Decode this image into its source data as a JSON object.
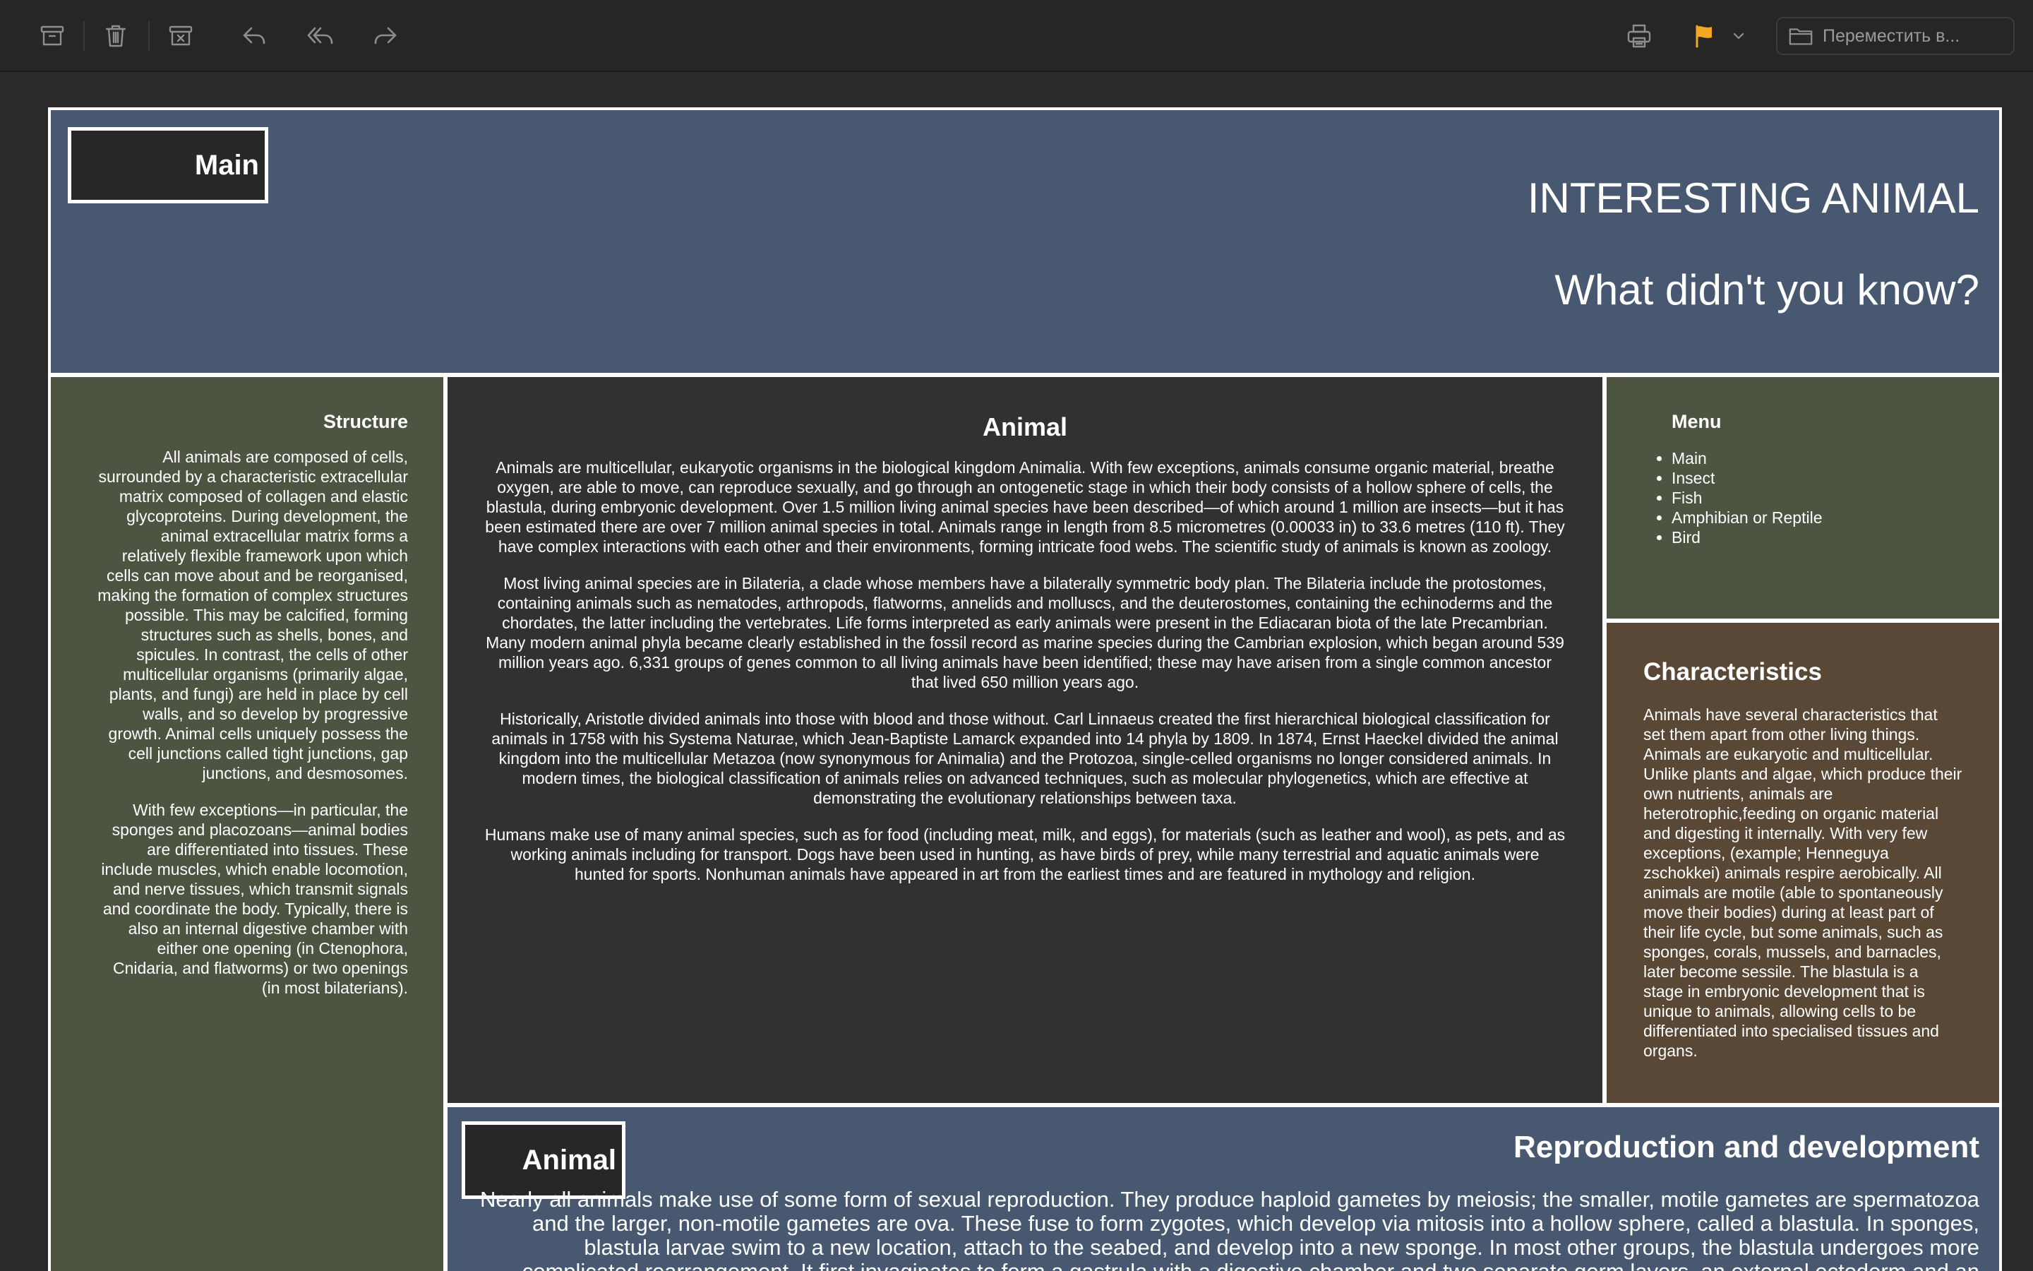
{
  "toolbar": {
    "buttons": [
      "archive-icon",
      "trash-icon",
      "junk-icon",
      "reply-icon",
      "reply-all-icon",
      "forward-icon",
      "print-icon",
      "flag-icon",
      "chevron-down-icon"
    ],
    "flag_color": "#f5a623",
    "move_to_placeholder": "Переместить в..."
  },
  "header": {
    "nav_button": "Main",
    "title": "INTERESTING ANIMAL",
    "subtitle": "What didn't you know?"
  },
  "structure": {
    "heading": "Structure",
    "paragraphs": [
      "All animals are composed of cells, surrounded by a characteristic extracellular matrix composed of collagen and elastic glycoproteins. During development, the animal extracellular matrix forms a relatively flexible framework upon which cells can move about and be reorganised, making the formation of complex structures possible. This may be calcified, forming structures such as shells, bones, and spicules. In contrast, the cells of other multicellular organisms (primarily algae, plants, and fungi) are held in place by cell walls, and so develop by progressive growth. Animal cells uniquely possess the cell junctions called tight junctions, gap junctions, and desmosomes.",
      "With few exceptions—in particular, the sponges and placozoans—animal bodies are differentiated into tissues. These include muscles, which enable locomotion, and nerve tissues, which transmit signals and coordinate the body. Typically, there is also an internal digestive chamber with either one opening (in Ctenophora, Cnidaria, and flatworms) or two openings (in most bilaterians)."
    ]
  },
  "animal": {
    "heading": "Animal",
    "paragraphs": [
      "Animals are multicellular, eukaryotic organisms in the biological kingdom Animalia. With few exceptions, animals consume organic material, breathe oxygen, are able to move, can reproduce sexually, and go through an ontogenetic stage in which their body consists of a hollow sphere of cells, the blastula, during embryonic development. Over 1.5 million living animal species have been described—of which around 1 million are insects—but it has been estimated there are over 7 million animal species in total. Animals range in length from 8.5 micrometres (0.00033 in) to 33.6 metres (110 ft). They have complex interactions with each other and their environments, forming intricate food webs. The scientific study of animals is known as zoology.",
      "Most living animal species are in Bilateria, a clade whose members have a bilaterally symmetric body plan. The Bilateria include the protostomes, containing animals such as nematodes, arthropods, flatworms, annelids and molluscs, and the deuterostomes, containing the echinoderms and the chordates, the latter including the vertebrates. Life forms interpreted as early animals were present in the Ediacaran biota of the late Precambrian. Many modern animal phyla became clearly established in the fossil record as marine species during the Cambrian explosion, which began around 539 million years ago. 6,331 groups of genes common to all living animals have been identified; these may have arisen from a single common ancestor that lived 650 million years ago.",
      "Historically, Aristotle divided animals into those with blood and those without. Carl Linnaeus created the first hierarchical biological classification for animals in 1758 with his Systema Naturae, which Jean-Baptiste Lamarck expanded into 14 phyla by 1809. In 1874, Ernst Haeckel divided the animal kingdom into the multicellular Metazoa (now synonymous for Animalia) and the Protozoa, single-celled organisms no longer considered animals. In modern times, the biological classification of animals relies on advanced techniques, such as molecular phylogenetics, which are effective at demonstrating the evolutionary relationships between taxa.",
      "Humans make use of many animal species, such as for food (including meat, milk, and eggs), for materials (such as leather and wool), as pets, and as working animals including for transport. Dogs have been used in hunting, as have birds of prey, while many terrestrial and aquatic animals were hunted for sports. Nonhuman animals have appeared in art from the earliest times and are featured in mythology and religion."
    ]
  },
  "menu": {
    "heading": "Menu",
    "items": [
      "Main",
      "Insect",
      "Fish",
      "Amphibian or Reptile",
      "Bird"
    ]
  },
  "characteristics": {
    "heading": "Characteristics",
    "text": "Animals have several characteristics that set them apart from other living things. Animals are eukaryotic and multicellular. Unlike plants and algae, which produce their own nutrients, animals are heterotrophic,feeding on organic material and digesting it internally. With very few exceptions, (example; Henneguya zschokkei) animals respire aerobically. All animals are motile (able to spontaneously move their bodies) during at least part of their life cycle, but some animals, such as sponges, corals, mussels, and barnacles, later become sessile. The blastula is a stage in embryonic development that is unique to animals, allowing cells to be differentiated into specialised tissues and organs."
  },
  "reproduction": {
    "nav_button": "Animal",
    "heading": "Reproduction and development",
    "text": "Nearly all animals make use of some form of sexual reproduction. They produce haploid gametes by meiosis; the smaller, motile gametes are spermatozoa and the larger, non-motile gametes are ova. These fuse to form zygotes, which develop via mitosis into a hollow sphere, called a blastula. In sponges, blastula larvae swim to a new location, attach to the seabed, and develop into a new sponge. In most other groups, the blastula undergoes more complicated rearrangement. It first invaginates to form a gastrula with a digestive chamber and two separate germ layers, an external ectoderm and an internal endoderm."
  },
  "colors": {
    "header_bg": "#475870",
    "sidebar_bg": "#4d5441",
    "center_bg": "#313131",
    "characteristics_bg": "#594836"
  }
}
